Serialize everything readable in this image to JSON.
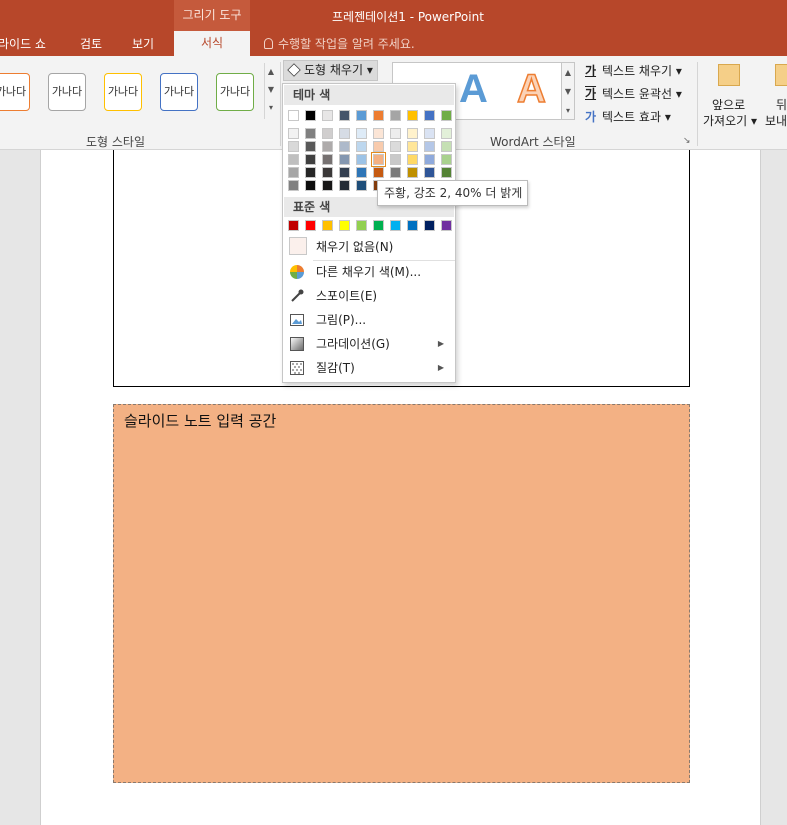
{
  "title_bar": {
    "contextual_tab_group": "그리기 도구",
    "window_title": "프레젠테이션1 - PowerPoint"
  },
  "ribbon_tabs": {
    "slideshow": "라이드 쇼",
    "review": "검토",
    "view": "보기",
    "format": "서식",
    "tell_me": "수행할 작업을 알려 주세요."
  },
  "ribbon": {
    "shape_style_sample": "가나다",
    "shape_styles_group": "도형 스타일",
    "shape_fill_button": "도형 채우기",
    "wordart_letter": "A",
    "wordart_group": "WordArt 스타일",
    "text_fill": "텍스트 채우기",
    "text_outline": "텍스트 윤곽선",
    "text_effects": "텍스트 효과",
    "text_glyph": "가",
    "bring_forward_line1": "앞으로",
    "bring_forward_line2": "가져오기",
    "send_backward_line1": "뒤",
    "send_backward_line2": "보내"
  },
  "fill_menu": {
    "theme_colors_header": "테마 색",
    "standard_colors_header": "표준 색",
    "theme_top_row": [
      "#ffffff",
      "#000000",
      "#e7e6e6",
      "#44546a",
      "#5b9bd5",
      "#ed7d31",
      "#a5a5a5",
      "#ffc000",
      "#4472c4",
      "#70ad47"
    ],
    "theme_shade_columns": [
      [
        "#f2f2f2",
        "#d9d9d9",
        "#bfbfbf",
        "#a6a6a6",
        "#808080"
      ],
      [
        "#808080",
        "#595959",
        "#404040",
        "#262626",
        "#0d0d0d"
      ],
      [
        "#d0cece",
        "#aeabab",
        "#767171",
        "#3b3838",
        "#181717"
      ],
      [
        "#d6dce5",
        "#adb9ca",
        "#8497b0",
        "#333f50",
        "#222a35"
      ],
      [
        "#deebf7",
        "#bdd7ee",
        "#9dc3e6",
        "#2e75b6",
        "#1f4e79"
      ],
      [
        "#fbe5d6",
        "#f8cbad",
        "#f4b183",
        "#c55a11",
        "#843c0c"
      ],
      [
        "#ededed",
        "#dbdbdb",
        "#c9c9c9",
        "#7b7b7b",
        "#525252"
      ],
      [
        "#fff2cc",
        "#ffe699",
        "#ffd966",
        "#bf9000",
        "#7f6000"
      ],
      [
        "#dae3f3",
        "#b4c7e7",
        "#8faadc",
        "#2f5597",
        "#203864"
      ],
      [
        "#e2f0d9",
        "#c5e0b4",
        "#a9d18e",
        "#548235",
        "#385723"
      ]
    ],
    "hover_swatch": "column 6, row 3",
    "standard_colors": [
      "#c00000",
      "#ff0000",
      "#ffc000",
      "#ffff00",
      "#92d050",
      "#00b050",
      "#00b0f0",
      "#0070c0",
      "#002060",
      "#7030a0"
    ],
    "no_fill": "채우기 없음(N)",
    "more_fill_colors": "다른 채우기 색(M)...",
    "eyedropper": "스포이트(E)",
    "picture": "그림(P)...",
    "gradient": "그라데이션(G)",
    "texture": "질감(T)"
  },
  "tooltip": "주황, 강조 2, 40% 더 밝게",
  "slide": {
    "notes_placeholder": "슬라이드 노트 입력 공간"
  },
  "colors": {
    "title_bar": "#b7472a",
    "notes_fill": "#f3b184"
  }
}
